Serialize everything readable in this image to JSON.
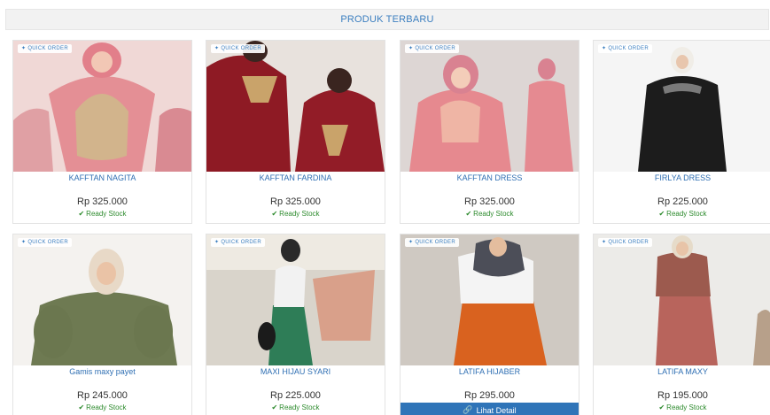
{
  "header": {
    "title": "PRODUK TERBARU"
  },
  "badge_label": "QUICK ORDER",
  "products": [
    {
      "name": "KAFFTAN NAGITA",
      "price": "Rp 325.000",
      "stock": "Ready Stock"
    },
    {
      "name": "KAFFTAN FARDINA",
      "price": "Rp 325.000",
      "stock": "Ready Stock"
    },
    {
      "name": "KAFFTAN DRESS",
      "price": "Rp 325.000",
      "stock": "Ready Stock"
    },
    {
      "name": "FIRLYA DRESS",
      "price": "Rp 225.000",
      "stock": "Ready Stock"
    },
    {
      "name": "Gamis maxy payet",
      "price": "Rp 245.000",
      "stock": "Ready Stock"
    },
    {
      "name": "MAXI HIJAU SYARI",
      "price": "Rp 225.000",
      "stock": "Ready Stock"
    },
    {
      "name": "LATIFA HIJABER",
      "price": "Rp 295.000",
      "detail_label": "Lihat Detail"
    },
    {
      "name": "LATIFA MAXY",
      "price": "Rp 195.000",
      "stock": "Ready Stock"
    }
  ],
  "icons": {
    "badge": "bolt-icon",
    "stock": "check-icon",
    "detail": "link-icon"
  },
  "colors": {
    "accent": "#3c7fc0",
    "stock": "#2e8b2e",
    "detail_button": "#2f74b8"
  }
}
